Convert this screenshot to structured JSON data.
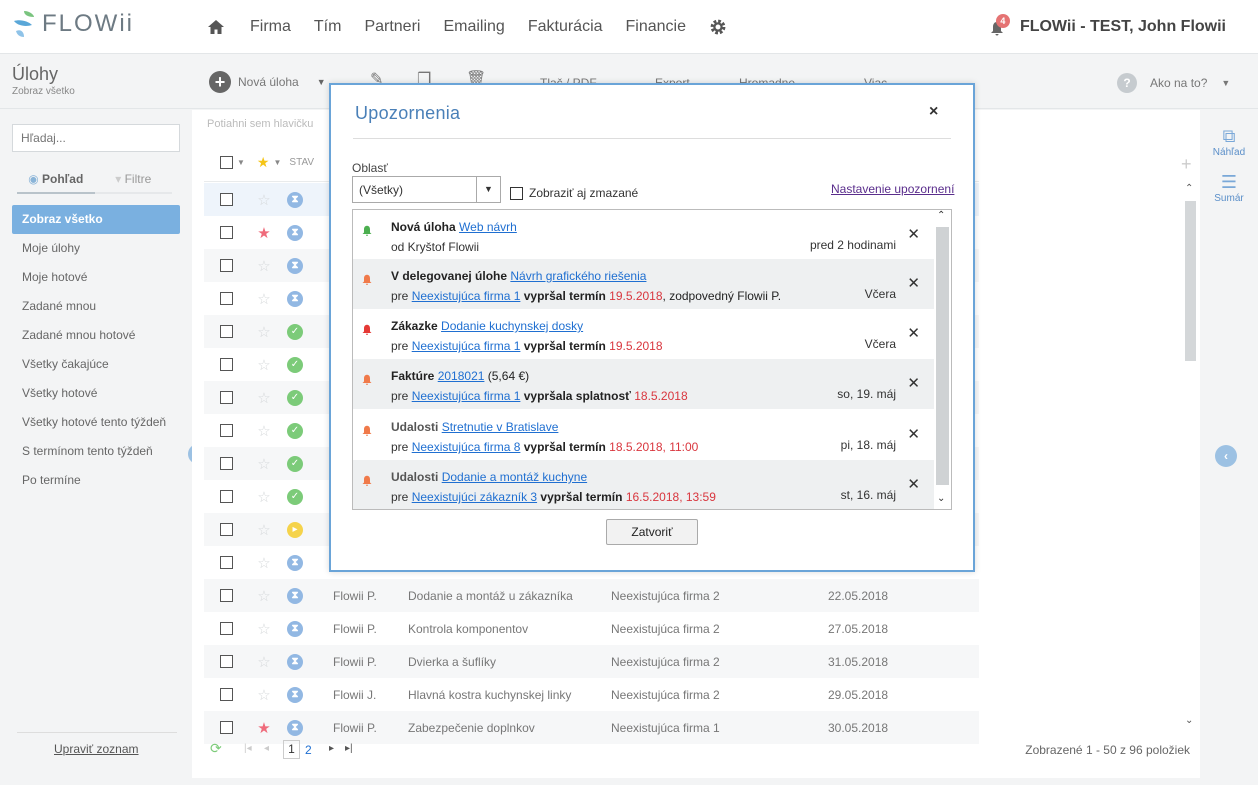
{
  "app": {
    "logo": "FLOWii"
  },
  "nav": {
    "items": [
      "Firma",
      "Tím",
      "Partneri",
      "Emailing",
      "Fakturácia",
      "Financie"
    ]
  },
  "user": {
    "name": "FLOWii - TEST, John Flowii",
    "notif_count": "4"
  },
  "page": {
    "title": "Úlohy",
    "subtitle": "Zobraz všetko"
  },
  "toolbar": {
    "new_task": "Nová úloha",
    "print": "Tlač / PDF",
    "export": "Export",
    "bulk": "Hromadne",
    "more": "Viac",
    "help": "Ako na to?"
  },
  "sidebar": {
    "search_placeholder": "Hľadaj...",
    "tab_view": "Pohľad",
    "tab_filter": "Filtre",
    "items": [
      "Zobraz všetko",
      "Moje úlohy",
      "Moje hotové",
      "Zadané mnou",
      "Zadané mnou hotové",
      "Všetky čakajúce",
      "Všetky hotové",
      "Všetky hotové tento týždeň",
      "S termínom tento týždeň",
      "Po termíne"
    ],
    "edit_list": "Upraviť zoznam"
  },
  "grid": {
    "drag_hint": "Potiahni sem hlavičku",
    "col_status": "STAV",
    "rows": [
      {
        "star": false,
        "status": "blue",
        "owner": "",
        "task": "",
        "company": "",
        "date": ""
      },
      {
        "star": true,
        "status": "blue",
        "owner": "",
        "task": "",
        "company": "",
        "date": ""
      },
      {
        "star": false,
        "status": "blue",
        "owner": "",
        "task": "",
        "company": "",
        "date": ""
      },
      {
        "star": false,
        "status": "blue",
        "owner": "",
        "task": "",
        "company": "",
        "date": ""
      },
      {
        "star": false,
        "status": "green",
        "owner": "",
        "task": "",
        "company": "",
        "date": ""
      },
      {
        "star": false,
        "status": "green",
        "owner": "",
        "task": "",
        "company": "",
        "date": ""
      },
      {
        "star": false,
        "status": "green",
        "owner": "",
        "task": "",
        "company": "",
        "date": ""
      },
      {
        "star": false,
        "status": "green",
        "owner": "",
        "task": "",
        "company": "",
        "date": ""
      },
      {
        "star": false,
        "status": "green",
        "owner": "",
        "task": "",
        "company": "",
        "date": ""
      },
      {
        "star": false,
        "status": "green",
        "owner": "",
        "task": "",
        "company": "",
        "date": ""
      },
      {
        "star": false,
        "status": "yellow",
        "owner": "",
        "task": "",
        "company": "",
        "date": ""
      },
      {
        "star": false,
        "status": "blue",
        "owner": "",
        "task": "",
        "company": "",
        "date": ""
      },
      {
        "star": false,
        "status": "blue",
        "owner": "Flowii P.",
        "task": "Dodanie a montáž u zákazníka",
        "company": "Neexistujúca firma 2",
        "date": "22.05.2018"
      },
      {
        "star": false,
        "status": "blue",
        "owner": "Flowii P.",
        "task": "Kontrola komponentov",
        "company": "Neexistujúca firma 2",
        "date": "27.05.2018"
      },
      {
        "star": false,
        "status": "blue",
        "owner": "Flowii P.",
        "task": "Dvierka a šuflíky",
        "company": "Neexistujúca firma 2",
        "date": "31.05.2018"
      },
      {
        "star": false,
        "status": "blue",
        "owner": "Flowii J.",
        "task": "Hlavná kostra kuchynskej linky",
        "company": "Neexistujúca firma 2",
        "date": "29.05.2018"
      },
      {
        "star": true,
        "status": "blue",
        "owner": "Flowii P.",
        "task": "Zabezpečenie doplnkov",
        "company": "Neexistujúca firma 1",
        "date": "30.05.2018"
      }
    ]
  },
  "pager": {
    "page1": "1",
    "page2": "2",
    "summary": "Zobrazené 1 - 50 z 96 položiek"
  },
  "right_panel": {
    "preview": "Náhľad",
    "summary": "Sumár"
  },
  "modal": {
    "title": "Upozornenia",
    "area_label": "Oblasť",
    "area_value": "(Všetky)",
    "show_deleted": "Zobraziť aj zmazané",
    "settings_link": "Nastavenie upozornení",
    "close_button": "Zatvoriť",
    "notifications": [
      {
        "bell": "#4caf50",
        "pre": "Nová úloha",
        "link": "Web návrh",
        "after": "",
        "l2_pre": "od Kryštof Flowii",
        "l2_link": "",
        "l2_bold": "",
        "l2_red": "",
        "l2_tail": "",
        "time": "pred 2 hodinami",
        "bold_pre": true
      },
      {
        "bell": "#f07a4a",
        "pre": "V delegovanej úlohe",
        "link": "Návrh grafického riešenia",
        "after": "",
        "l2_pre": "pre",
        "l2_link": "Neexistujúca firma 1",
        "l2_bold": "vypršal termín",
        "l2_red": "19.5.2018",
        "l2_tail": ", zodpovedný Flowii P.",
        "time": "Včera",
        "bold_pre": true
      },
      {
        "bell": "#e53935",
        "pre": "Zákazke",
        "link": "Dodanie kuchynskej dosky",
        "after": "",
        "l2_pre": "pre",
        "l2_link": "Neexistujúca firma 1",
        "l2_bold": "vypršal termín",
        "l2_red": "19.5.2018",
        "l2_tail": "",
        "time": "Včera",
        "bold_pre": true
      },
      {
        "bell": "#f07a4a",
        "pre": "Faktúre",
        "link": "2018021",
        "after": "(5,64 €)",
        "l2_pre": "pre",
        "l2_link": "Neexistujúca firma 1",
        "l2_bold": "vypršala splatnosť",
        "l2_red": "18.5.2018",
        "l2_tail": "",
        "time": "so, 19. máj",
        "bold_pre": true
      },
      {
        "bell": "#f07a4a",
        "pre": "Udalosti",
        "link": "Stretnutie v Bratislave",
        "after": "",
        "l2_pre": "pre",
        "l2_link": "Neexistujúca firma 8",
        "l2_bold": "vypršal termín",
        "l2_red": "18.5.2018, 11:00",
        "l2_tail": "",
        "time": "pi, 18. máj",
        "bold_pre": false
      },
      {
        "bell": "#f07a4a",
        "pre": "Udalosti",
        "link": "Dodanie a montáž kuchyne",
        "after": "",
        "l2_pre": "pre",
        "l2_link": "Neexistujúci zákazník 3",
        "l2_bold": "vypršal termín",
        "l2_red": "16.5.2018, 13:59",
        "l2_tail": "",
        "time": "st, 16. máj",
        "bold_pre": false
      }
    ]
  }
}
